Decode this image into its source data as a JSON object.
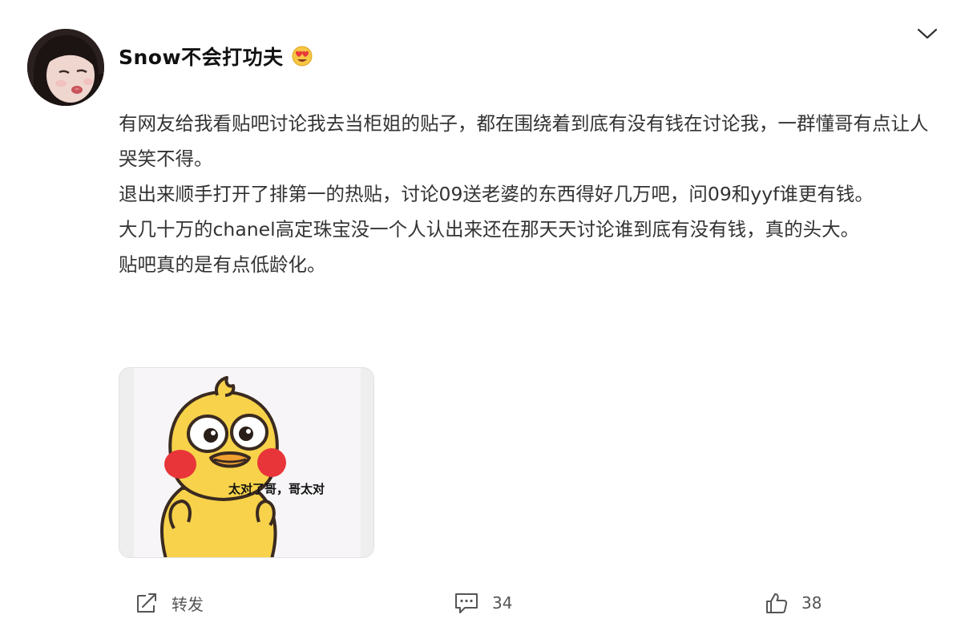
{
  "post": {
    "username": "Snow不会打功夫",
    "badge_icon": "heart-eyes-emoji-icon",
    "paragraphs": [
      "有网友给我看贴吧讨论我去当柜姐的贴子，都在围绕着到底有没有钱在讨论我，一群懂哥有点让人哭笑不得。",
      "退出来顺手打开了排第一的热贴，讨论09送老婆的东西得好几万吧，问09和yyf谁更有钱。",
      "大几十万的chanel高定珠宝没一个人认出来还在那天天讨论谁到底有没有钱，真的头大。",
      "贴吧真的是有点低龄化。"
    ],
    "sticker": {
      "caption": "太对了哥，哥太对",
      "icon": "yellow-duck-sticker"
    }
  },
  "actions": {
    "repost_label": "转发",
    "comment_count": "34",
    "like_count": "38"
  },
  "colors": {
    "text": "#333333",
    "username": "#111111",
    "action_text": "#555555",
    "duck_yellow": "#f7d24a",
    "duck_blush": "#e8353a",
    "duck_beak": "#f0a030"
  }
}
